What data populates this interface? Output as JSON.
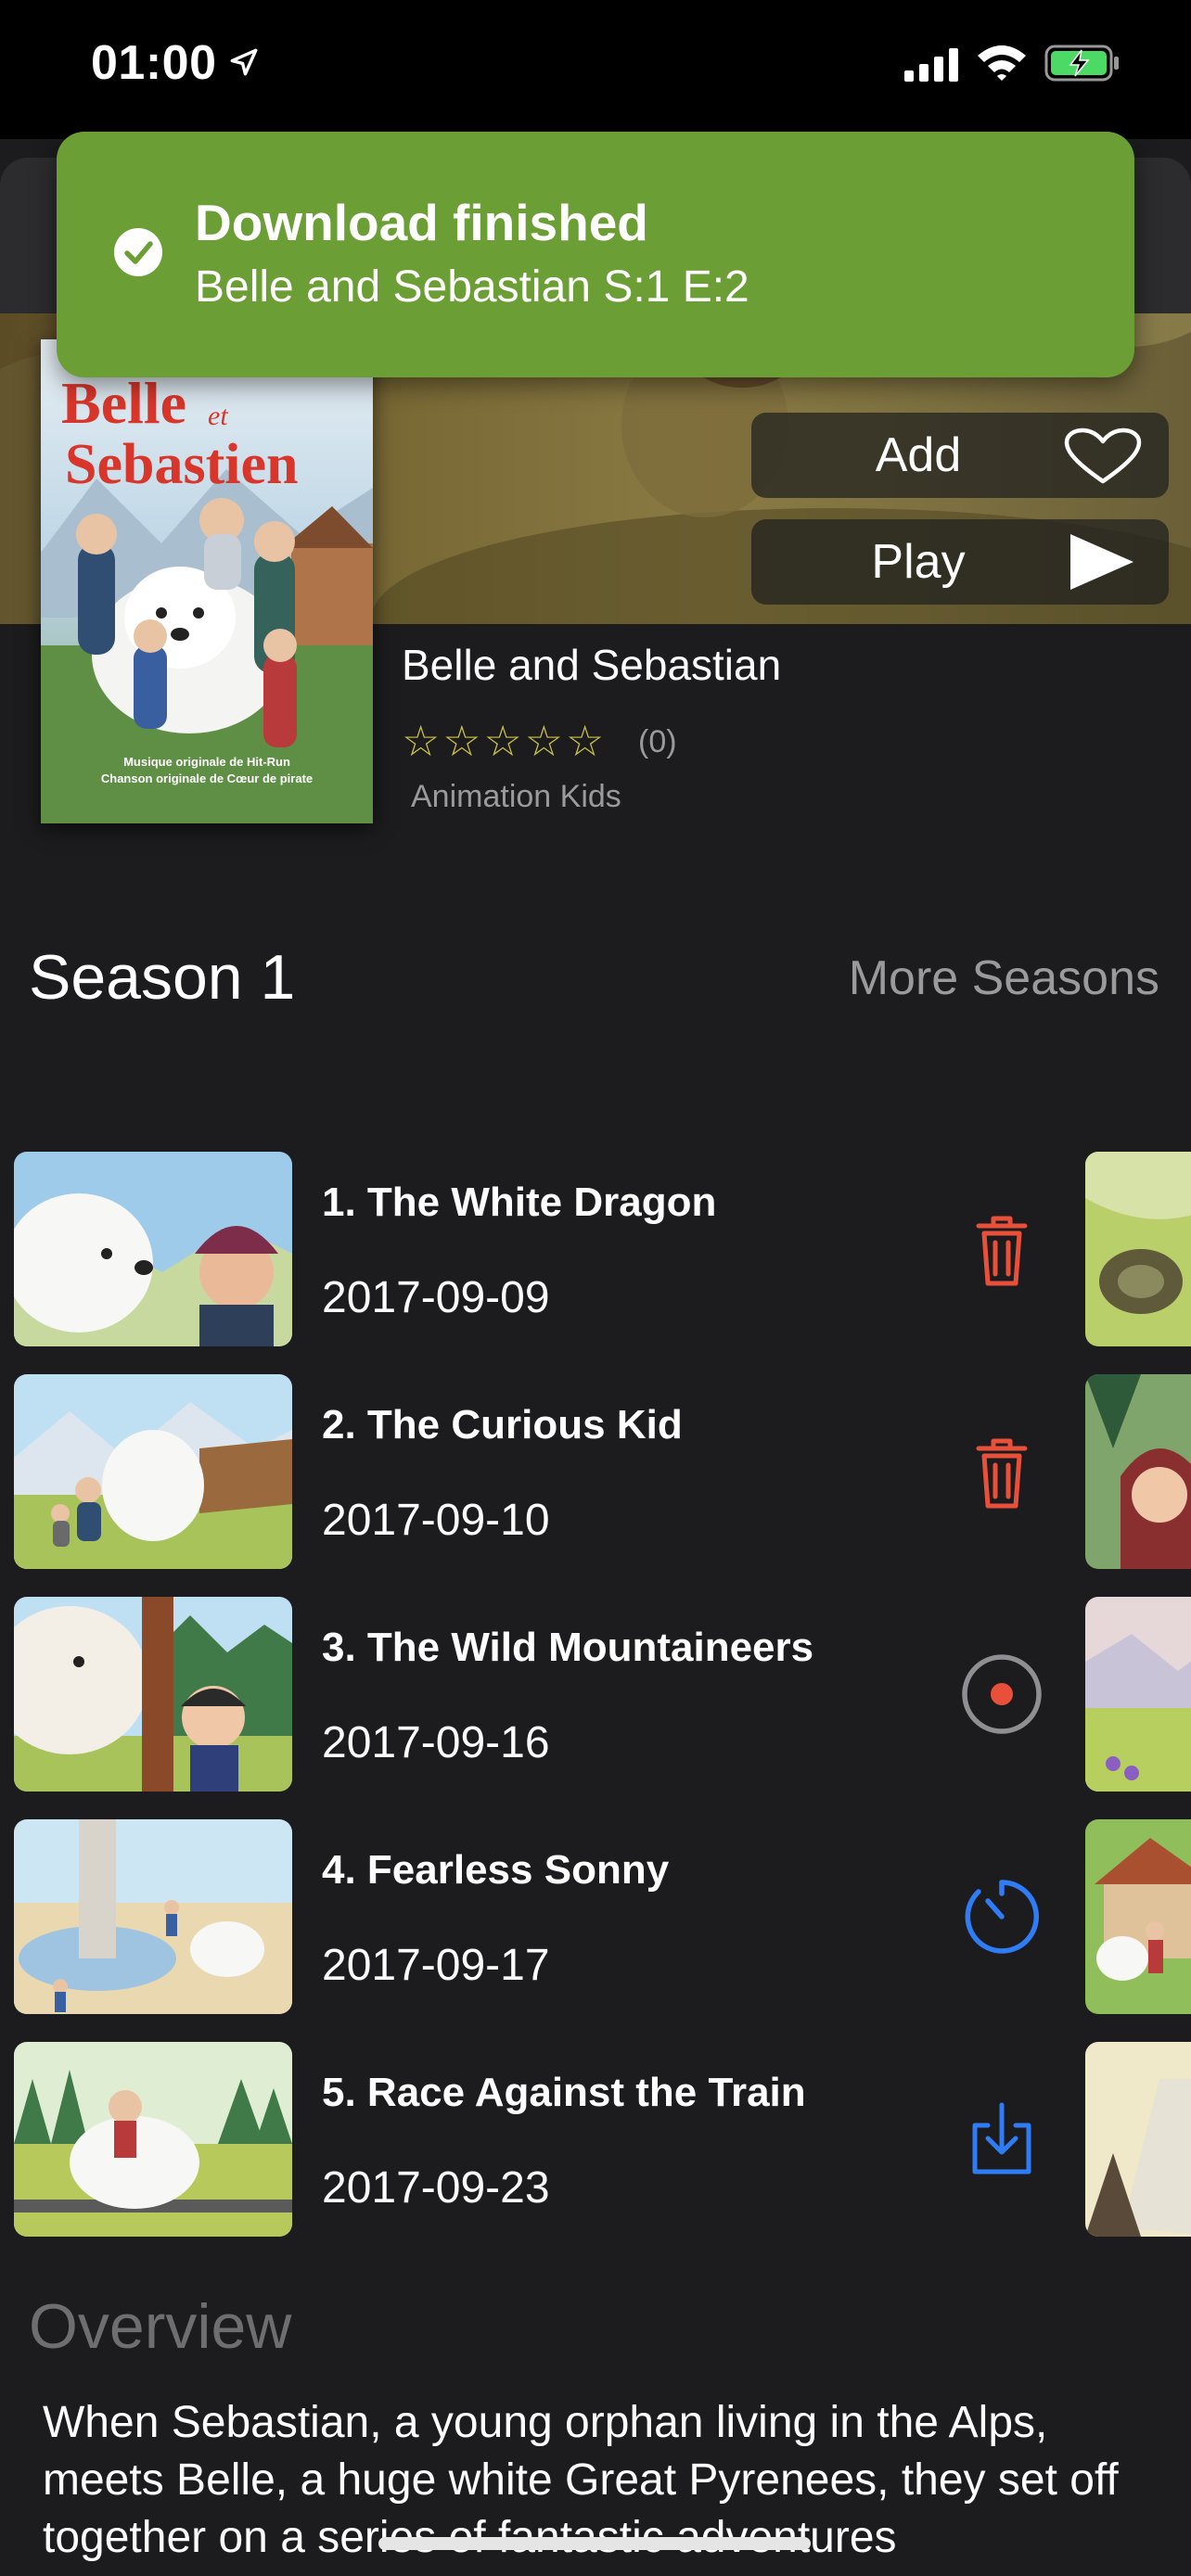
{
  "status_bar": {
    "time": "01:00",
    "icons": [
      "location-arrow-icon",
      "cellular-signal-icon",
      "wifi-icon",
      "battery-charging-icon"
    ]
  },
  "toast": {
    "title": "Download finished",
    "subtitle": "Belle and Sebastian S:1 E:2",
    "icon": "checkmark-circle-icon",
    "color": "#6b9f35"
  },
  "actions": {
    "add_label": "Add",
    "add_icon": "heart-icon",
    "play_label": "Play",
    "play_icon": "play-icon"
  },
  "poster": {
    "title_line1": "Belle",
    "title_small": "et",
    "title_line2": "Sebastien",
    "credit_line1": "Musique originale de Hit-Run",
    "credit_line2": "Chanson originale de Cœur de pirate"
  },
  "show": {
    "title": "Belle and Sebastian",
    "stars": "☆☆☆☆☆",
    "rating_count": "(0)",
    "genres": "Animation Kids"
  },
  "season": {
    "label": "Season 1",
    "more_label": "More Seasons"
  },
  "episodes": [
    {
      "title": "1. The White Dragon",
      "date": "2017-09-09",
      "action_icon": "trash-icon",
      "action_color": "#e8503a"
    },
    {
      "title": "2. The Curious Kid",
      "date": "2017-09-10",
      "action_icon": "trash-icon",
      "action_color": "#e8503a"
    },
    {
      "title": "3. The Wild Mountaineers",
      "date": "2017-09-16",
      "action_icon": "stop-download-icon",
      "action_color": "#e8503a"
    },
    {
      "title": "4. Fearless Sonny",
      "date": "2017-09-17",
      "action_icon": "timer-queued-icon",
      "action_color": "#2f7df6"
    },
    {
      "title": "5. Race Against the Train",
      "date": "2017-09-23",
      "action_icon": "download-icon",
      "action_color": "#2f7df6"
    }
  ],
  "overview": {
    "label": "Overview",
    "text": "When Sebastian, a young orphan living in the Alps, meets Belle, a huge white Great Pyrenees, they set off together on a series of fantastic adventures"
  }
}
